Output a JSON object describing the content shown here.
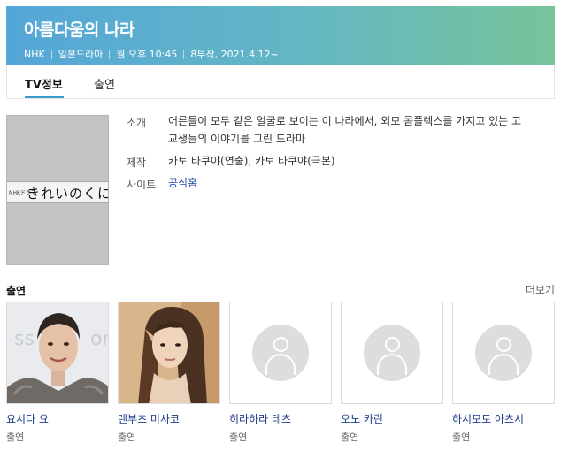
{
  "header": {
    "title": "아름다움의 나라",
    "meta": [
      "NHK",
      "일본드라마",
      "월 오후 10:45",
      "8부작, 2021.4.12~"
    ]
  },
  "tabs": [
    {
      "label": "TV정보",
      "active": true
    },
    {
      "label": "출연",
      "active": false
    }
  ],
  "poster": {
    "small_text": "NHKドラマ",
    "logo_text": "きれいのくに"
  },
  "info": {
    "synopsis_label": "소개",
    "synopsis": "어른들이 모두 같은 얼굴로 보이는 이 나라에서, 외모 콤플렉스를 가지고 있는 고교생들의 이야기를 그린 드라마",
    "production_label": "제작",
    "production": "카토 타쿠야(연출), 카토 타쿠야(극본)",
    "site_label": "사이트",
    "site": "공식홈"
  },
  "cast_section": {
    "title": "출연",
    "more": "더보기"
  },
  "cast": [
    {
      "name": "요시다 요",
      "role": "출연",
      "photo": "photo"
    },
    {
      "name": "렌부츠 미사코",
      "role": "출연",
      "photo": "photo"
    },
    {
      "name": "히라하라 테츠",
      "role": "출연",
      "photo": "placeholder"
    },
    {
      "name": "오노 카린",
      "role": "출연",
      "photo": "placeholder"
    },
    {
      "name": "하시모토 아츠시",
      "role": "출연",
      "photo": "placeholder"
    }
  ],
  "colors": {
    "header_gradient_start": "#54a6d8",
    "header_gradient_end": "#77c49a",
    "tab_indicator": "#3a9bc8",
    "link": "#1a4aa8",
    "cast_name": "#1b3a88"
  },
  "icons": {
    "cast_placeholder": "person-silhouette-icon"
  }
}
